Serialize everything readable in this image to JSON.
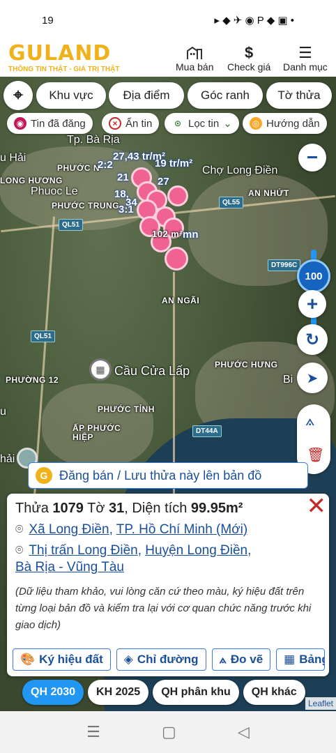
{
  "status": {
    "time": "19",
    "indicators": "▸ ◆ ✈ ◉ P ◆ ▣ •"
  },
  "header": {
    "brand": "GULAND",
    "tagline": "THÔNG TIN THẬT - GIÁ TRỊ THẬT",
    "nav": [
      {
        "icon": "building-icon",
        "label": "Mua bán"
      },
      {
        "icon": "dollar-icon",
        "label": "Check giá"
      },
      {
        "icon": "menu-icon",
        "label": "Danh mục"
      }
    ]
  },
  "filters": {
    "area": "Khu vực",
    "place": "Địa điểm",
    "corner": "Góc ranh",
    "sheet": "Tờ thửa"
  },
  "chips": {
    "posted": "Tin đã đăng",
    "hidden": "Ẩn tin",
    "filter": "Lọc tin",
    "guide": "Hướng dẫn"
  },
  "map": {
    "labels": {
      "ba_ria": "Tp. Bà Rịa",
      "hai": "u Hải",
      "phuoc_n": "PHƯỚC N",
      "long_huong": "LONG HƯƠNG",
      "phuoc_le": "Phuoc Le",
      "phuoc_trung": "PHƯỚC TRUNG",
      "cho_long_dien": "Chợ Long Điền",
      "an_nhut": "AN NHỨT",
      "an_ngai": "AN NGÃI",
      "cau_cua_lap": "Cầu Cửa Lấp",
      "phuoc_hung": "PHƯỚC HƯNG",
      "phuong_12": "PHƯỜNG 12",
      "phuoc_tinh": "PHƯỚC TỈNH",
      "ap_phuoc_hiep": "ẤP PHƯỚC\nHIỆP",
      "bi": "Bi",
      "u": "u",
      "hai2": "hải"
    },
    "shields": {
      "ql51a": "QL51",
      "ql51b": "QL51",
      "ql55": "QL55",
      "dt996c": "DT996C",
      "dt44a": "DT44A"
    },
    "parcel_labels": [
      "27,43 tr/m²",
      "2:2",
      "19 tr/m²",
      "21",
      "27",
      "18,",
      "34",
      "3:1",
      "102 m²",
      "mn"
    ],
    "zoom": "100"
  },
  "banner": {
    "text": "Đăng bán / Lưu thửa này lên bản đồ"
  },
  "parcel": {
    "thua_label": "Thửa",
    "thua": "1079",
    "to_label": "Tờ",
    "to": "31",
    "area_label": "Diện tích",
    "area": "99.95m²",
    "commune_new": "Xã Long Điền",
    "city_new": "TP. Hồ Chí Minh (Mới)",
    "town_old": "Thị trấn Long Điền",
    "district_old": "Huyện Long Điền",
    "province_old": "Bà Rịa - Vũng Tàu",
    "note": "(Dữ liệu tham khảo, vui lòng căn cứ theo màu, ký hiệu đất trên từng loại bản đồ và kiểm tra lại với cơ quan chức năng trước khi giao dịch)"
  },
  "actions": {
    "symbols": "Ký hiệu đất",
    "directions": "Chỉ đường",
    "measure": "Đo vẽ",
    "table": "Bảng"
  },
  "plan_tabs": [
    "QH 2030",
    "KH 2025",
    "QH phân khu",
    "QH khác"
  ],
  "attribution": "Leaflet"
}
